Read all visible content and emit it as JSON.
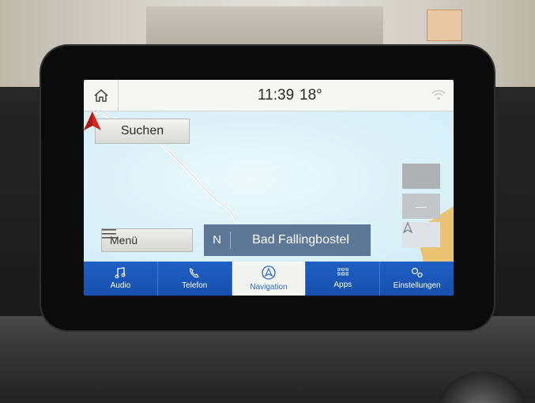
{
  "status_bar": {
    "home_icon": "home-icon",
    "time": "11:39",
    "temperature": "18°",
    "wifi_icon": "wifi-icon"
  },
  "map": {
    "search_label": "Suchen",
    "menu_label": "Menü",
    "heading": "N",
    "destination": "Bad Fallingbostel",
    "zoom_out_symbol": "—",
    "compass_icon": "navigation-arrow-icon",
    "vehicle_icon": "vehicle-position-icon"
  },
  "nav": {
    "items": [
      {
        "label": "Audio",
        "icon": "music-note-icon",
        "active": false
      },
      {
        "label": "Telefon",
        "icon": "phone-icon",
        "active": false
      },
      {
        "label": "Navigation",
        "icon": "navigation-icon",
        "active": true
      },
      {
        "label": "Apps",
        "icon": "apps-grid-icon",
        "active": false
      },
      {
        "label": "Einstellungen",
        "icon": "settings-gears-icon",
        "active": false
      }
    ]
  },
  "colors": {
    "nav_blue": "#1e5fc4",
    "destination_bar": "#5d7896",
    "map_water": "#dff3f9",
    "vehicle_red": "#d8261c"
  }
}
